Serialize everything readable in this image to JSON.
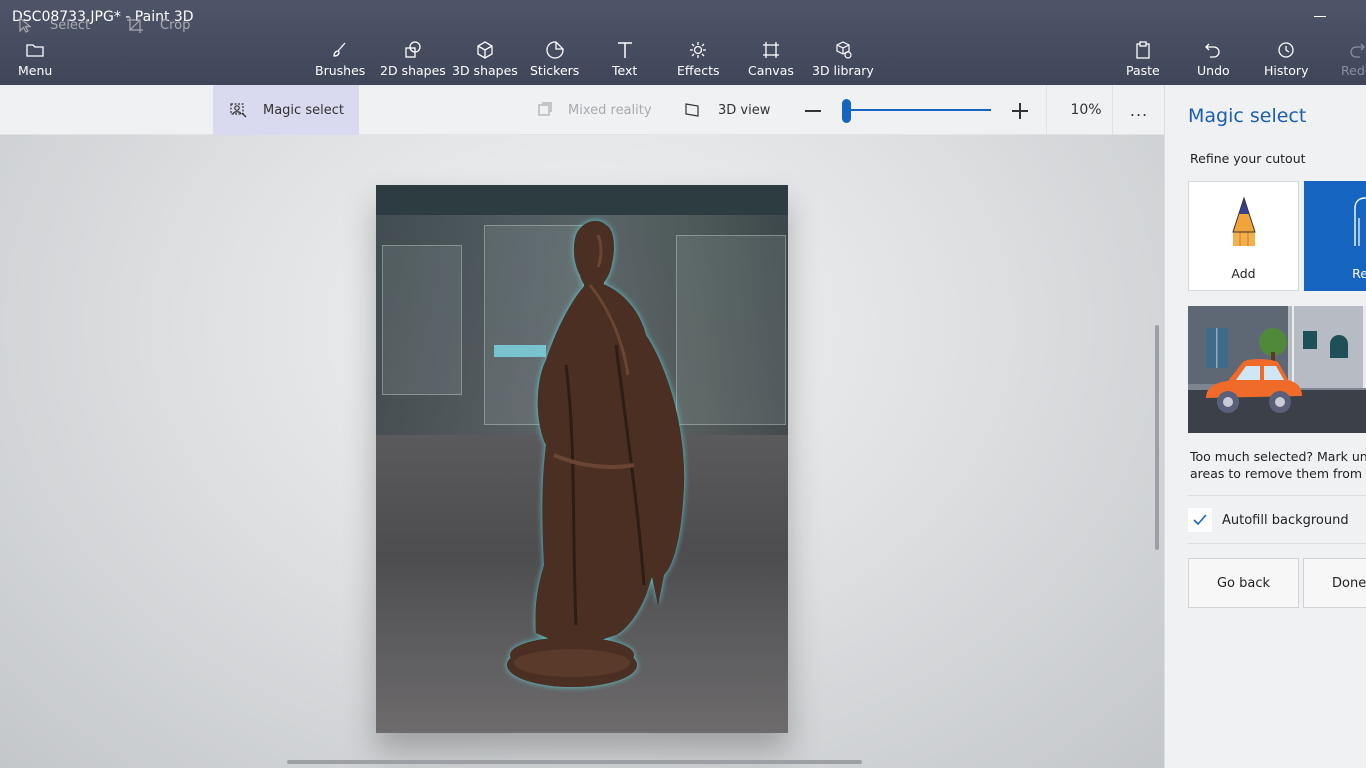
{
  "window": {
    "title": "DSC08733.JPG* - Paint 3D"
  },
  "menu": {
    "label": "Menu"
  },
  "tools": [
    {
      "label": "Brushes",
      "icon": "brush-icon"
    },
    {
      "label": "2D shapes",
      "icon": "2d-shapes-icon"
    },
    {
      "label": "3D shapes",
      "icon": "3d-shapes-icon"
    },
    {
      "label": "Stickers",
      "icon": "stickers-icon"
    },
    {
      "label": "Text",
      "icon": "text-icon"
    },
    {
      "label": "Effects",
      "icon": "effects-icon"
    },
    {
      "label": "Canvas",
      "icon": "canvas-icon"
    },
    {
      "label": "3D library",
      "icon": "3d-library-icon"
    }
  ],
  "actions": {
    "paste": "Paste",
    "undo": "Undo",
    "history": "History",
    "redo": "Redo"
  },
  "subtoolbar": {
    "select": "Select",
    "crop": "Crop",
    "magic_select": "Magic select",
    "mixed_reality": "Mixed reality",
    "view_3d": "3D view",
    "zoom_level": "10%",
    "zoom_fraction": 0.04,
    "more": "..."
  },
  "panel": {
    "title": "Magic select",
    "subtitle": "Refine your cutout",
    "add_label": "Add",
    "remove_label": "Remove",
    "help_line1": "Too much selected? Mark unwanted",
    "help_line2": "areas to remove them from your",
    "autofill_label": "Autofill background",
    "autofill_checked": true,
    "go_back_label": "Go back",
    "done_label": "Done"
  },
  "colors": {
    "accent": "#1565c0",
    "selection_glow": "#5fd3d8",
    "header": "#484e62"
  }
}
